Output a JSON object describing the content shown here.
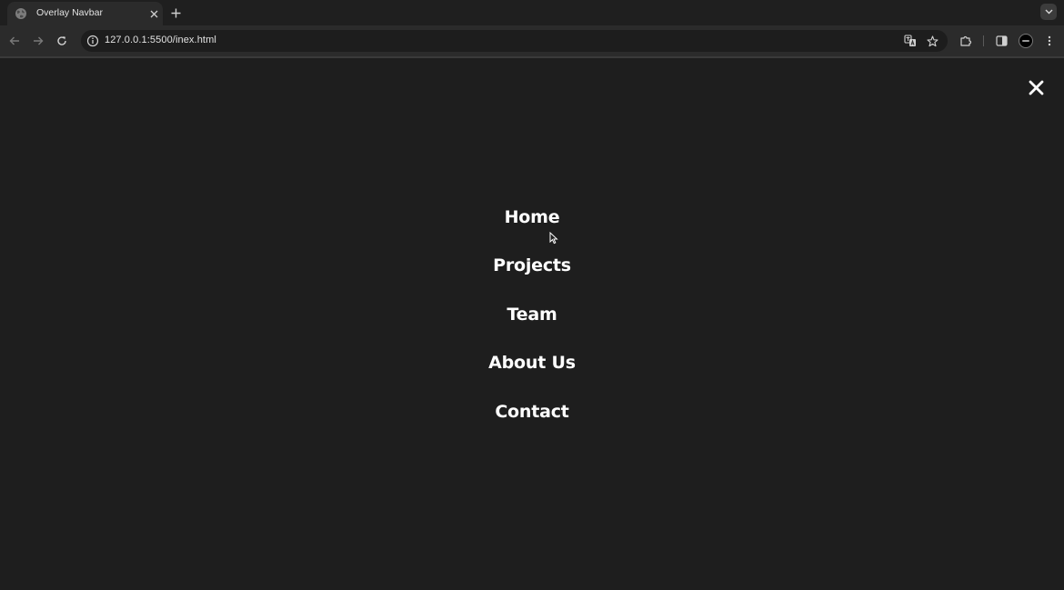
{
  "browser": {
    "tab": {
      "title": "Overlay Navbar",
      "favicon": "globe-icon"
    },
    "url": "127.0.0.1:5500/inex.html",
    "icons": {
      "back": "arrow-left-icon",
      "forward": "arrow-right-icon",
      "reload": "reload-icon",
      "site_info": "info-icon",
      "translate": "translate-icon",
      "bookmark": "star-icon",
      "extensions": "puzzle-icon",
      "side_panel": "side-panel-icon",
      "menu": "kebab-menu-icon"
    }
  },
  "page": {
    "background": "#1e1e1e",
    "close_icon": "close-icon",
    "nav": [
      {
        "label": "Home"
      },
      {
        "label": "Projects"
      },
      {
        "label": "Team"
      },
      {
        "label": "About Us"
      },
      {
        "label": "Contact"
      }
    ]
  }
}
